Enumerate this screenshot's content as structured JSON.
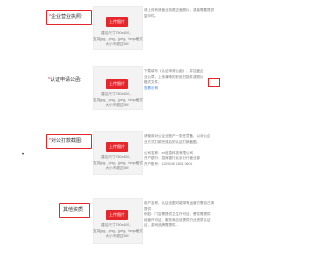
{
  "rows": [
    {
      "label_req": "*",
      "label": "企业营业执照:",
      "button": "上传图片",
      "help": [
        "建议尺寸750x400，",
        "支持jpg、png、jpeg、bmp格式",
        "大小不超过5M"
      ],
      "desc": [
        "请上传有效营业执照正面照片，或者需要提供",
        "复印件。"
      ]
    },
    {
      "label_req": "*",
      "label": "认证申请公函:",
      "button": "上传图片",
      "help": [
        "建议尺寸750x400，",
        "支持jpg、png、jpeg、bmp格式",
        "大小不超过5M"
      ],
      "desc": [
        "下载填写《认证申请公函》，并加盖企",
        "业公章，上传清晰的彩色扫描件或照片",
        "格式文件。",
        "查看示例"
      ],
      "desc_link": "认证申请公函",
      "desc_action": "下载"
    },
    {
      "label_req": "*",
      "label": "对公打款截图:",
      "button": "上传图片",
      "help": [
        "建议尺寸750x400，",
        "支持jpg、png、jpeg、bmp格式",
        "大小不超过5M"
      ],
      "desc": [
        "请使用对公企业账户一张任意备，以对公企",
        "业方式打款完成后的认证打款截图。",
        "",
        "公司名称：xx信息科技有限公司",
        "开户银行：招商银行北京分行营业部",
        "开户账号：1109245 1801 0601"
      ]
    },
    {
      "label_req": "",
      "label": "其他资质",
      "button": "上传图片",
      "help": [
        "建议尺寸750x400，",
        "支持jpg、png、jpeg、bmp格式",
        "大小不超过5M"
      ],
      "desc": [
        "用户名称、认证全图可能带有运营方需自己请",
        "提供",
        "例如：门店需提供卫生许可证，餐饮需提供",
        "经营许可证，服务商应该提供行业资质认证",
        "证，游戏品牌需提供..."
      ]
    }
  ]
}
